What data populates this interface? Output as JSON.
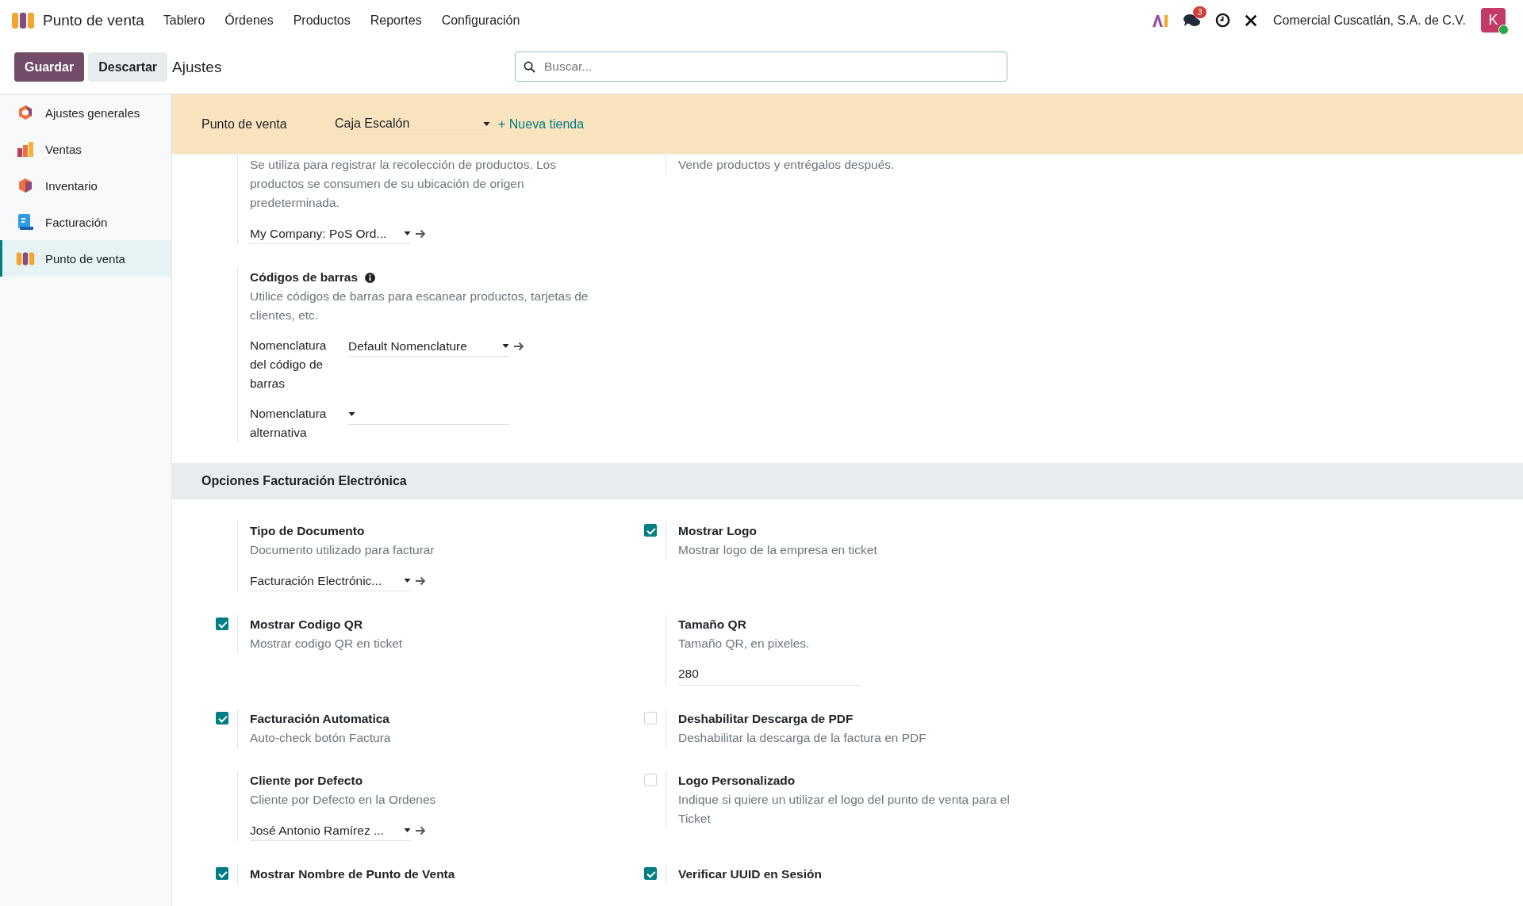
{
  "navbar": {
    "app_name": "Punto de venta",
    "menu": [
      "Tablero",
      "Órdenes",
      "Productos",
      "Reportes",
      "Configuración"
    ],
    "messages_badge": "3",
    "company": "Comercial Cuscatlán, S.A. de C.V.",
    "avatar_initial": "K"
  },
  "control_panel": {
    "save": "Guardar",
    "discard": "Descartar",
    "breadcrumb": "Ajustes",
    "search": {
      "placeholder": "Buscar..."
    }
  },
  "sidebar": {
    "items": [
      {
        "label": "Ajustes generales",
        "selected": false
      },
      {
        "label": "Ventas",
        "selected": false
      },
      {
        "label": "Inventario",
        "selected": false
      },
      {
        "label": "Facturación",
        "selected": false
      },
      {
        "label": "Punto de venta",
        "selected": true
      }
    ]
  },
  "store_bar": {
    "label": "Punto de venta",
    "value": "Caja Escalón",
    "new_store": "+ Nueva tienda"
  },
  "sections": [
    {
      "rows": [
        {
          "left": {
            "kind": "plain",
            "description": "Se utiliza para registrar la recolección de productos. Los productos se consumen de su ubicación de origen predeterminada.",
            "fields": [
              {
                "kind": "many2one",
                "value": "My Company: PoS Ord..."
              }
            ]
          },
          "right": {
            "kind": "plain",
            "description": "Vende productos y entrégalos después."
          }
        },
        {
          "left": {
            "kind": "plain",
            "title": "Códigos de barras",
            "info": true,
            "description": "Utilice códigos de barras para escanear productos, tarjetas de clientes, etc.",
            "fields": [
              {
                "kind": "many2one",
                "label": "Nomenclatura del código de barras",
                "value": "Default Nomenclature"
              },
              {
                "kind": "select",
                "label": "Nomenclatura alternativa"
              }
            ]
          }
        }
      ]
    },
    {
      "title": "Opciones Facturación Electrónica",
      "rows": [
        {
          "left": {
            "kind": "plain",
            "title": "Tipo de Documento",
            "description": "Documento utilizado para facturar",
            "fields": [
              {
                "kind": "many2one",
                "value": "Facturación Electrónic..."
              }
            ]
          },
          "right": {
            "kind": "checkbox",
            "checked": true,
            "title": "Mostrar Logo",
            "description": "Mostrar logo de la empresa en ticket"
          }
        },
        {
          "left": {
            "kind": "checkbox",
            "checked": true,
            "title": "Mostrar Codigo QR",
            "description": "Mostrar codigo QR en ticket"
          },
          "right": {
            "kind": "plain",
            "title": "Tamaño QR",
            "description": "Tamaño QR, en pixeles.",
            "fields": [
              {
                "kind": "input",
                "value": "280"
              }
            ]
          }
        },
        {
          "left": {
            "kind": "checkbox",
            "checked": true,
            "title": "Facturación Automatica",
            "description": "Auto-check botón Factura"
          },
          "right": {
            "kind": "checkbox",
            "checked": false,
            "title": "Deshabilitar Descarga de PDF",
            "description": "Deshabilitar la descarga de la factura en PDF"
          }
        },
        {
          "left": {
            "kind": "plain",
            "title": "Cliente por Defecto",
            "description": "Cliente por Defecto en la Ordenes",
            "fields": [
              {
                "kind": "many2one",
                "value": "José Antonio Ramírez ..."
              }
            ]
          },
          "right": {
            "kind": "checkbox",
            "checked": false,
            "title": "Logo Personalizado",
            "description": "Indique si quiere un utilizar el logo del punto de venta para el Ticket"
          }
        },
        {
          "left": {
            "kind": "checkbox",
            "checked": true,
            "title": "Mostrar Nombre de Punto de Venta"
          },
          "right": {
            "kind": "checkbox",
            "checked": true,
            "title": "Verificar UUID en Sesión"
          }
        }
      ]
    }
  ]
}
